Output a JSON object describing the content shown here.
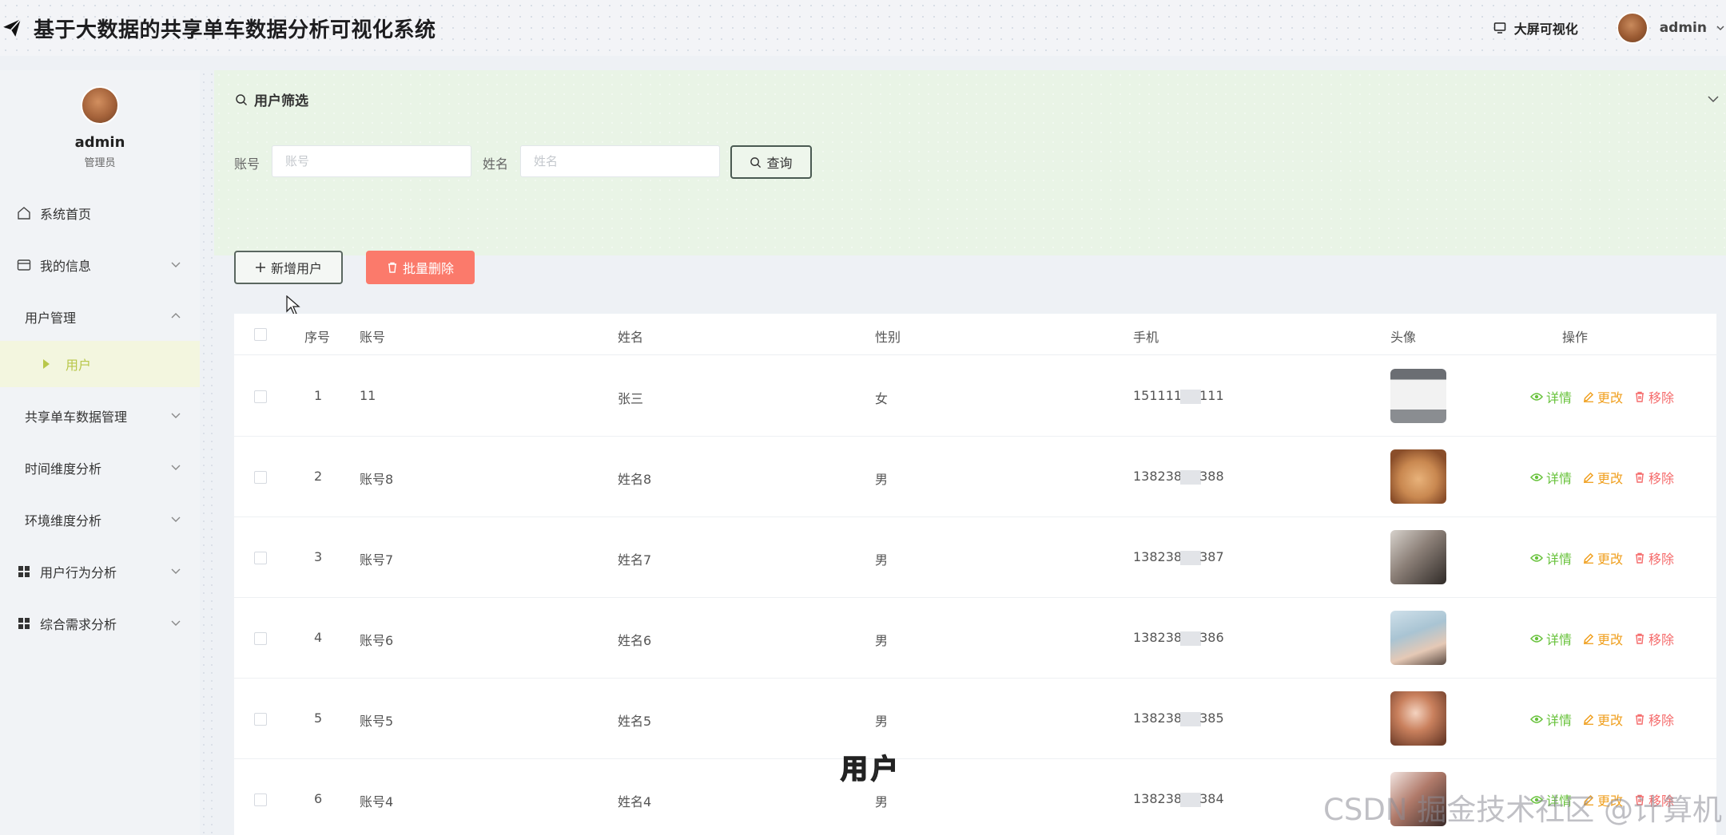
{
  "header": {
    "title": "基于大数据的共享单车数据分析可视化系统",
    "bigscreen_label": "大屏可视化",
    "username": "admin"
  },
  "sidebar": {
    "profile": {
      "name": "admin",
      "role": "管理员"
    },
    "items": [
      {
        "label": "系统首页",
        "icon": "home-icon"
      },
      {
        "label": "我的信息",
        "icon": "card-icon"
      },
      {
        "label": "用户管理",
        "icon": ""
      },
      {
        "label": "共享单车数据管理",
        "icon": ""
      },
      {
        "label": "时间维度分析",
        "icon": ""
      },
      {
        "label": "环境维度分析",
        "icon": ""
      },
      {
        "label": "用户行为分析",
        "icon": "grid-icon"
      },
      {
        "label": "综合需求分析",
        "icon": "grid-icon"
      }
    ],
    "active_sub": "用户"
  },
  "filter": {
    "title": "用户筛选",
    "account_label": "账号",
    "account_placeholder": "账号",
    "name_label": "姓名",
    "name_placeholder": "姓名",
    "query_label": "查询"
  },
  "toolbar": {
    "add_label": "新增用户",
    "batch_delete_label": "批量删除"
  },
  "table": {
    "columns": [
      "序号",
      "账号",
      "姓名",
      "性别",
      "手机",
      "头像",
      "操作"
    ],
    "rows": [
      {
        "index": "1",
        "account": "11",
        "name": "张三",
        "gender": "女",
        "phone_a": "151111",
        "phone_b": "111"
      },
      {
        "index": "2",
        "account": "账号8",
        "name": "姓名8",
        "gender": "男",
        "phone_a": "138238",
        "phone_b": "388"
      },
      {
        "index": "3",
        "account": "账号7",
        "name": "姓名7",
        "gender": "男",
        "phone_a": "138238",
        "phone_b": "387"
      },
      {
        "index": "4",
        "account": "账号6",
        "name": "姓名6",
        "gender": "男",
        "phone_a": "138238",
        "phone_b": "386"
      },
      {
        "index": "5",
        "account": "账号5",
        "name": "姓名5",
        "gender": "男",
        "phone_a": "138238",
        "phone_b": "385"
      },
      {
        "index": "6",
        "account": "账号4",
        "name": "姓名4",
        "gender": "男",
        "phone_a": "138238",
        "phone_b": "384"
      }
    ],
    "actions": {
      "detail": "详情",
      "edit": "更改",
      "remove": "移除"
    }
  },
  "overlay": {
    "subtitle": "用户",
    "watermark": "CSDN 掘金技术社区 @计算机毕设指导师"
  },
  "colors": {
    "accent_green": "#67c23a",
    "edit_orange": "#f0a020",
    "danger_red": "#f56c6c",
    "batch_delete_bg": "#fb7a6b",
    "active_sub_text": "#b8c74a"
  }
}
